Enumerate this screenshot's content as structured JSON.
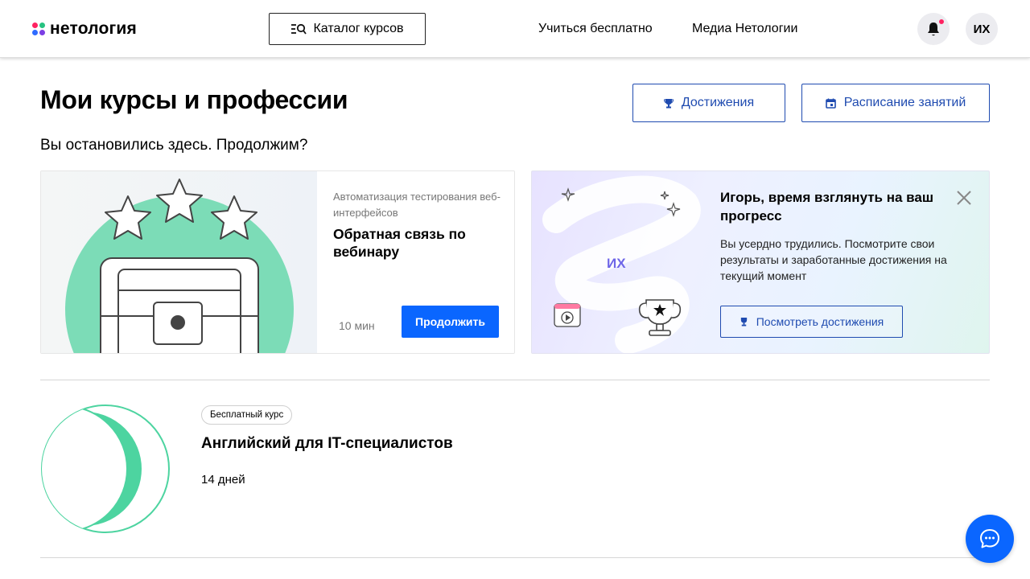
{
  "header": {
    "logo_text": "нетология",
    "catalog_label": "Каталог курсов",
    "nav": [
      {
        "label": "Учиться бесплатно"
      },
      {
        "label": "Медиа Нетологии"
      }
    ],
    "user_initials": "ИХ",
    "has_notification": true
  },
  "page": {
    "title": "Мои курсы и профессии",
    "achievements_label": "Достижения",
    "schedule_label": "Расписание занятий",
    "subtitle": "Вы остановились здесь. Продолжим?"
  },
  "continue_card": {
    "course_category": "Автоматизация тестирования веб-интерфейсов",
    "lesson_title": "Обратная связь по вебинару",
    "duration": "10 мин",
    "continue_label": "Продолжить"
  },
  "progress_card": {
    "title": "Игорь, время взглянуть на ваш прогресс",
    "text": "Вы усердно трудились. Посмотрите свои результаты и заработанные достижения на текущий момент",
    "button_label": "Посмотреть достижения",
    "avatar_initials": "ИХ"
  },
  "courses": [
    {
      "badge": "Бесплатный курс",
      "title": "Английский для IT-специалистов",
      "duration": "14 дней"
    }
  ],
  "colors": {
    "accent_blue": "#0a66ff",
    "outline_blue": "#1f4bb0",
    "green": "#4dd4a0",
    "notification_red": "#ff2261"
  },
  "icons": {
    "catalog": "catalog-search-icon",
    "bell": "bell-icon",
    "trophy": "trophy-icon",
    "calendar": "calendar-icon",
    "close": "close-icon",
    "chat": "chat-icon"
  }
}
